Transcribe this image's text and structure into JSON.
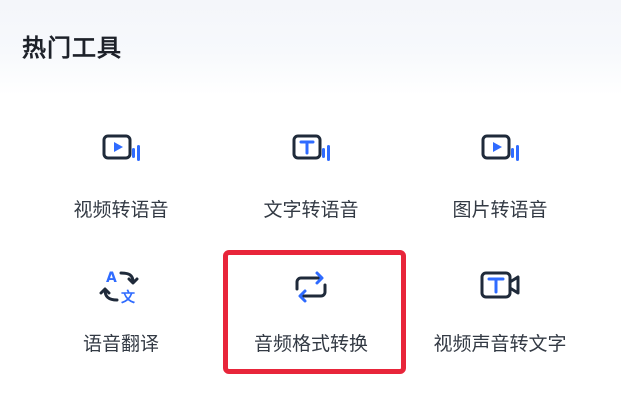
{
  "section_title": "热门工具",
  "colors": {
    "icon_dark": "#1f2a3a",
    "icon_accent": "#2f6bff",
    "highlight": "#e8253a"
  },
  "tools": [
    {
      "label": "视频转语音",
      "icon": "video-to-audio-icon"
    },
    {
      "label": "文字转语音",
      "icon": "text-to-speech-icon"
    },
    {
      "label": "图片转语音",
      "icon": "image-to-audio-icon"
    },
    {
      "label": "语音翻译",
      "icon": "translate-icon"
    },
    {
      "label": "音频格式转换",
      "icon": "format-convert-icon"
    },
    {
      "label": "视频声音转文字",
      "icon": "video-text-icon"
    }
  ]
}
